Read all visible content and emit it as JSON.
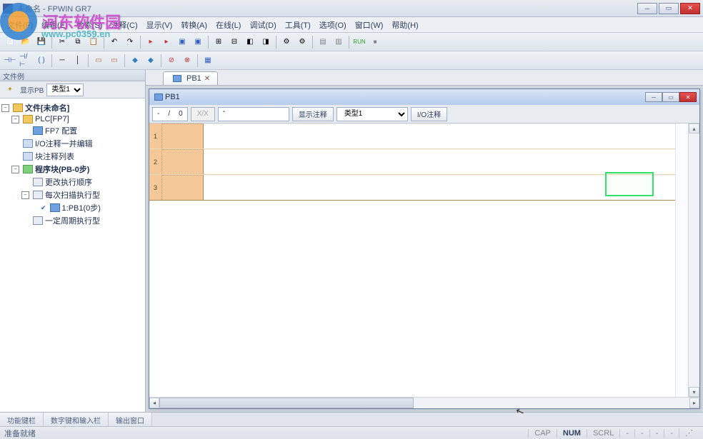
{
  "window": {
    "title": "未命名 - FPWIN GR7"
  },
  "watermark": {
    "brand": "河东软件园",
    "url": "www.pc0359.en"
  },
  "menu": {
    "file": "文件(F)",
    "edit": "编辑(E)",
    "search": "检索(S)",
    "comment": "注释(C)",
    "view": "显示(V)",
    "convert": "转换(A)",
    "online": "在线(L)",
    "debug": "调试(D)",
    "tool": "工具(T)",
    "option": "选项(O)",
    "window": "窗口(W)",
    "help": "帮助(H)"
  },
  "sidebar": {
    "header": "文件例",
    "label_pb": "显示PB",
    "select_type": "类型1",
    "tree": {
      "root": "文件[未命名]",
      "plc": "PLC[FP7]",
      "fp7": "FP7 配置",
      "io": "I/O注释一并编辑",
      "block": "块注释列表",
      "prog": "程序块(PB-0步)",
      "exec": "更改执行顺序",
      "scan": "每次扫描执行型",
      "pb1": "1:PB1(0步)",
      "period": "一定周期执行型"
    }
  },
  "editor": {
    "tab": "PB1",
    "sub_title": "PB1",
    "position": {
      "cur": "-",
      "sep": "/",
      "total": "0"
    },
    "btn_comment": "显示注释",
    "dd_type": "类型1",
    "btn_io": "I/O注释",
    "rows": [
      "1",
      "2",
      "3"
    ]
  },
  "bottom_tabs": {
    "t1": "功能键栏",
    "t2": "数字键和输入栏",
    "t3": "输出窗口"
  },
  "status": {
    "ready": "准备就绪",
    "cap": "CAP",
    "num": "NUM",
    "scrl": "SCRL",
    "dash": "-"
  }
}
